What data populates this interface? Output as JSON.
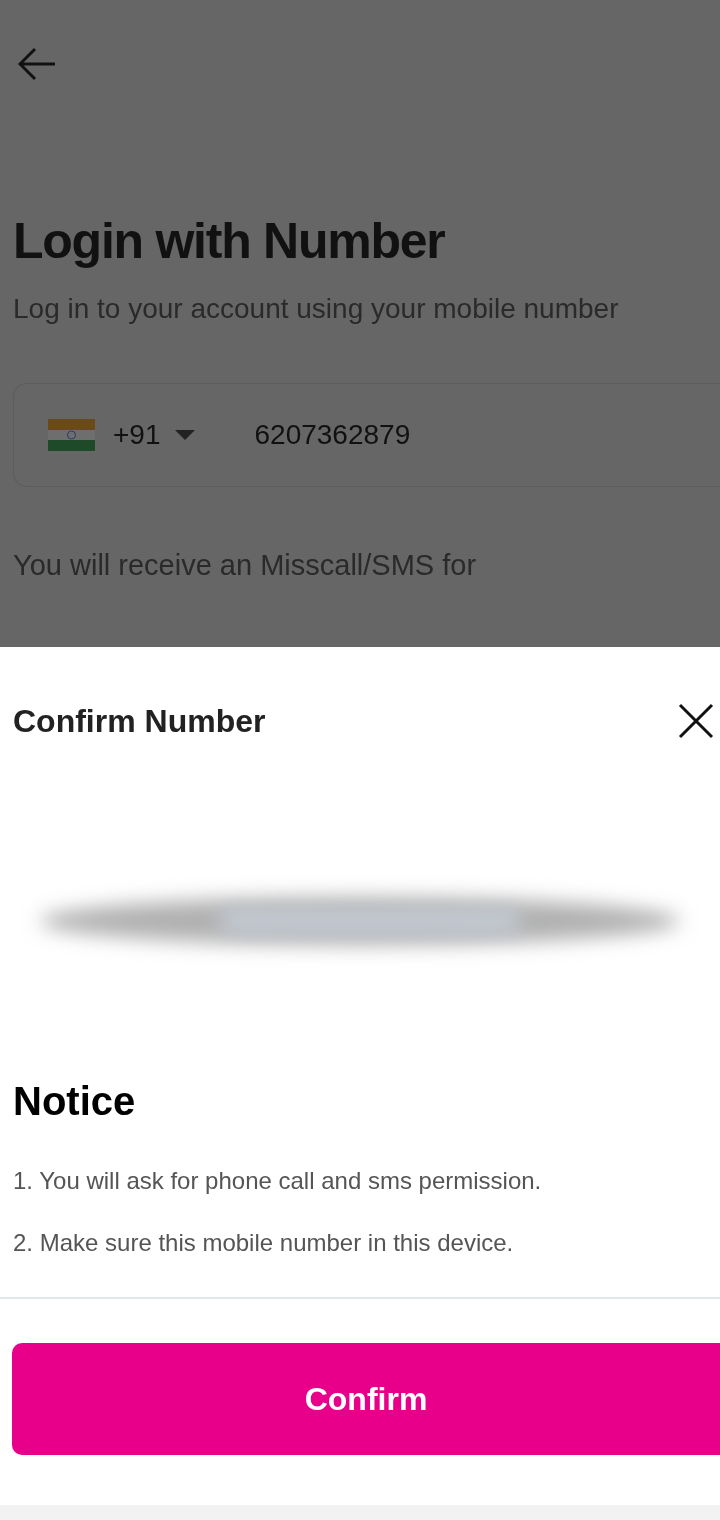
{
  "page": {
    "title": "Login with Number",
    "subtitle": "Log in to your account using your mobile number",
    "phone_field": {
      "country_code": "+91",
      "value": "6207362879"
    },
    "info": "You will receive an Misscall/SMS for"
  },
  "sheet": {
    "title": "Confirm Number",
    "notice_title": "Notice",
    "notices": [
      "1. You will ask for phone call and sms permission.",
      "2. Make sure this mobile number in this device."
    ],
    "confirm_button": "Confirm"
  }
}
